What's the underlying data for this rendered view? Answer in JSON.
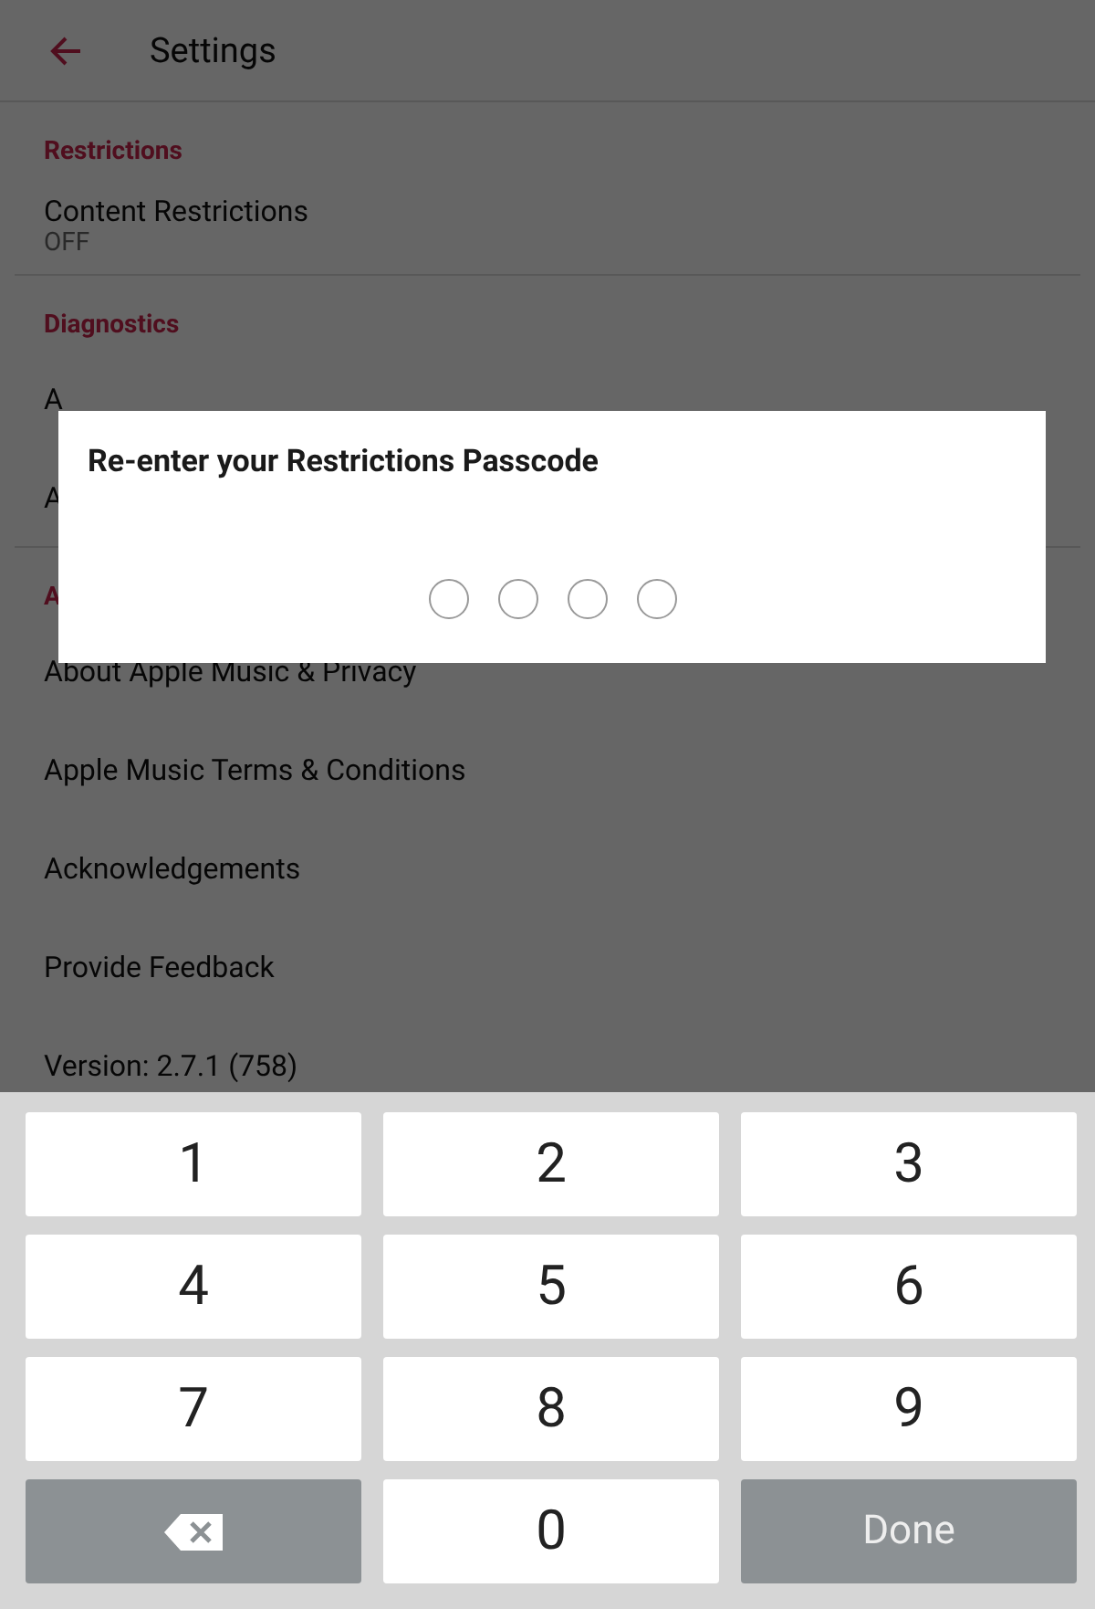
{
  "header": {
    "title": "Settings"
  },
  "sections": [
    {
      "heading": "Restrictions",
      "items": [
        {
          "label": "Content Restrictions",
          "value": "OFF"
        }
      ],
      "divider": true
    },
    {
      "heading": "Diagnostics",
      "items": [
        {
          "label": "A"
        },
        {
          "label": "A"
        }
      ],
      "divider": true
    },
    {
      "heading": "A",
      "items": [
        {
          "label": "About Apple Music & Privacy"
        },
        {
          "label": "Apple Music Terms & Conditions"
        },
        {
          "label": "Acknowledgements"
        },
        {
          "label": "Provide Feedback"
        },
        {
          "label": "Version: 2.7.1 (758)"
        }
      ],
      "divider": false
    }
  ],
  "dialog": {
    "title": "Re-enter your Restrictions Passcode",
    "digits": [
      {
        "filled": false
      },
      {
        "filled": false
      },
      {
        "filled": false
      },
      {
        "filled": false
      }
    ]
  },
  "keypad": [
    {
      "kind": "digit",
      "label": "1"
    },
    {
      "kind": "digit",
      "label": "2"
    },
    {
      "kind": "digit",
      "label": "3"
    },
    {
      "kind": "digit",
      "label": "4"
    },
    {
      "kind": "digit",
      "label": "5"
    },
    {
      "kind": "digit",
      "label": "6"
    },
    {
      "kind": "digit",
      "label": "7"
    },
    {
      "kind": "digit",
      "label": "8"
    },
    {
      "kind": "digit",
      "label": "9"
    },
    {
      "kind": "backspace"
    },
    {
      "kind": "digit",
      "label": "0"
    },
    {
      "kind": "action",
      "label": "Done"
    }
  ]
}
